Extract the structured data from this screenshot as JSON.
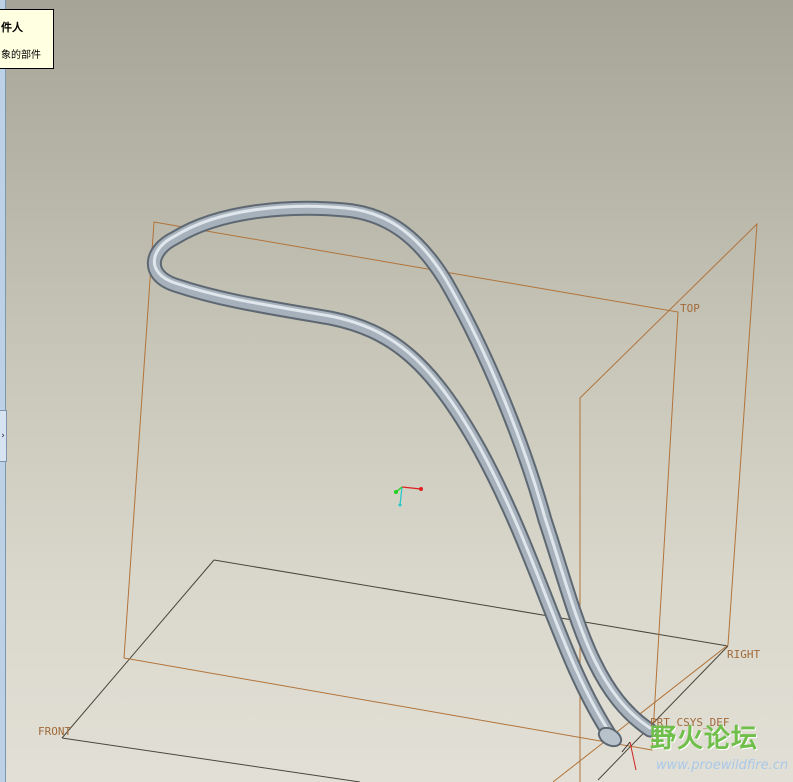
{
  "tooltip": {
    "line1": "件人",
    "line2": "象的部件"
  },
  "sidebar": {
    "toggle_glyph": "›"
  },
  "datum_planes": {
    "top": "TOP",
    "right": "RIGHT",
    "front": "FRONT"
  },
  "csys_label": "PRT_CSYS_DEF",
  "colors": {
    "plane_edge": "#b2733a",
    "ground_edge": "#4a463c",
    "tube": "#8a96a2",
    "label": "#a06a3a"
  },
  "watermark": {
    "title": "野火论坛",
    "url": "www.proewildfire.cn"
  }
}
